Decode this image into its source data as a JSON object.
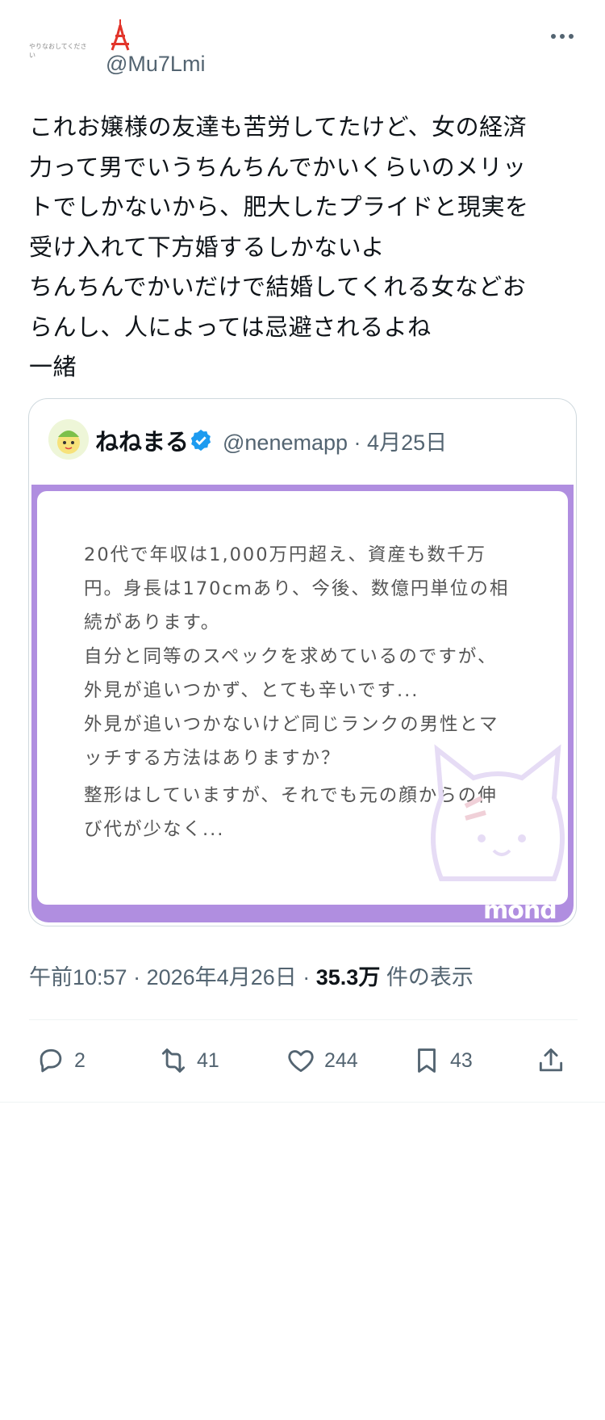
{
  "author": {
    "avatar_caption": "やりなおしてください",
    "handle": "@Mu7Lmi"
  },
  "tweet": {
    "text": "これお嬢様の友達も苦労してたけど、女の経済\n力って男でいうちんちんでかいくらいのメリッ\nトでしかないから、肥大したプライドと現実を\n受け入れて下方婚するしかないよ\nちんちんでかいだけで結婚してくれる女などお\nらんし、人によっては忌避されるよね\n一緒"
  },
  "quote": {
    "name": "ねねまる",
    "handle": "@nenemapp",
    "separator": "·",
    "date": "4月25日",
    "paragraphs": [
      "20代で年収は1,000万円超え、資産も数千万\n円。身長は170cmあり、今後、数億円単位の相\n続があります。",
      "自分と同等のスペックを求めているのですが、\n外見が追いつかず、とても辛いです...",
      "外見が追いつかないけど同じランクの男性とマ\nッチする方法はありますか？",
      "整形はしていますが、それでも元の顔からの伸\nび代が少なく..."
    ],
    "watermark": "mond"
  },
  "meta": {
    "time": "午前10:57",
    "date": "2026年4月26日",
    "views": "35.3万",
    "views_label": "件の表示",
    "dot": "·"
  },
  "actions": {
    "replies": "2",
    "reposts": "41",
    "likes": "244",
    "bookmarks": "43"
  },
  "colors": {
    "accent": "#1d9bf0",
    "text_secondary": "#536471",
    "card_border": "#b08ee0"
  },
  "icons": [
    "more-icon",
    "tokyo-tower-icon",
    "verified-badge-icon",
    "reply-icon",
    "repost-icon",
    "like-icon",
    "bookmark-icon",
    "share-icon"
  ]
}
